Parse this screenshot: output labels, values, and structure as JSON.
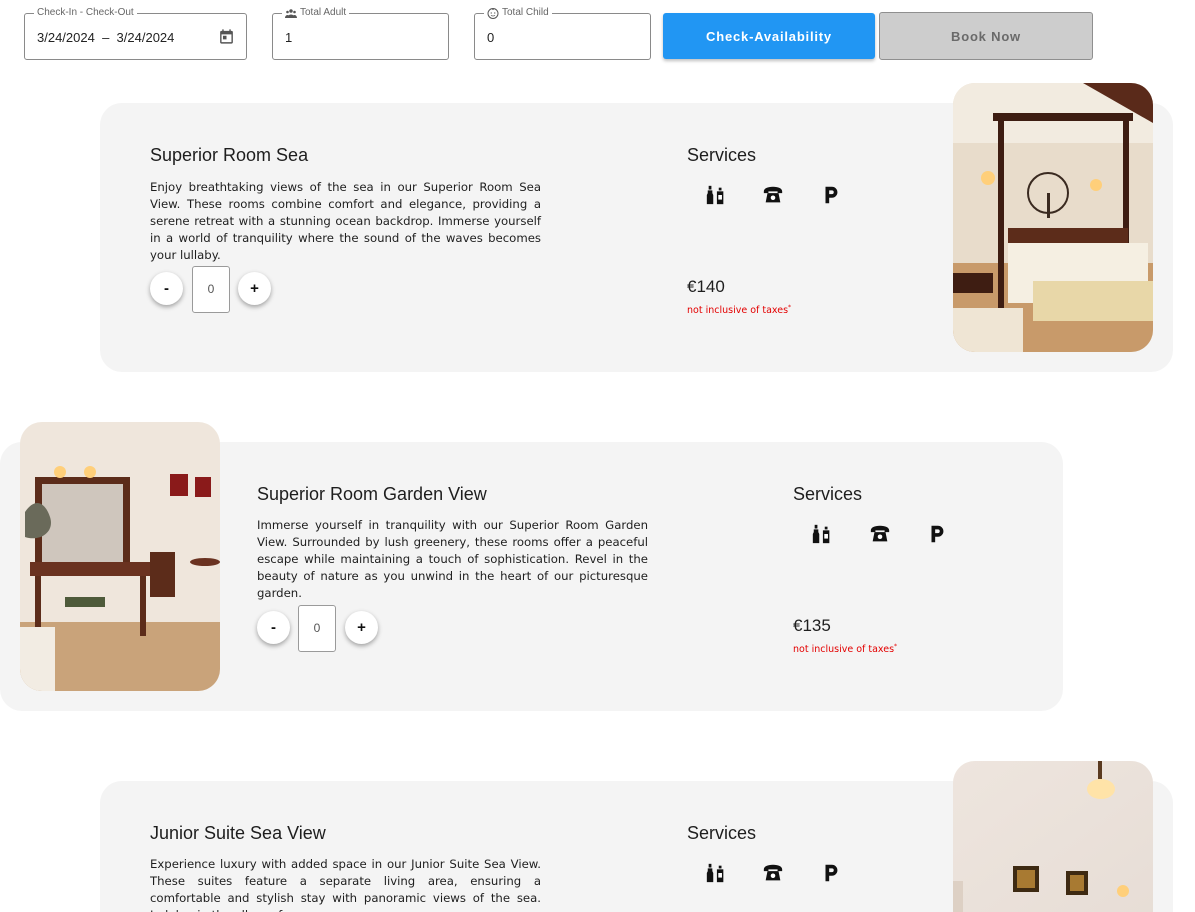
{
  "search": {
    "dates_label": "Check-In - Check-Out",
    "check_in": "3/24/2024",
    "separator": "–",
    "check_out": "3/24/2024",
    "adult_label": "Total Adult",
    "adult_value": "1",
    "child_label": "Total Child",
    "child_value": "0",
    "check_button": "Check-Availability",
    "book_button": "Book Now"
  },
  "rooms": [
    {
      "title": "Superior Room Sea",
      "description": "Enjoy breathtaking views of the sea in our Superior Room Sea View. These rooms combine comfort and elegance, providing a serene retreat with a stunning ocean backdrop. Immerse yourself in a world of tranquility where the sound of the waves becomes your lullaby.",
      "quantity": "0",
      "services_title": "Services",
      "price": "€140",
      "tax_note": "not inclusive of taxes",
      "tax_mark": "*"
    },
    {
      "title": "Superior Room Garden View",
      "description": "Immerse yourself in tranquility with our Superior Room Garden View. Surrounded by lush greenery, these rooms offer a peaceful escape while maintaining a touch of sophistication. Revel in the beauty of nature as you unwind in the heart of our picturesque garden.",
      "quantity": "0",
      "services_title": "Services",
      "price": "€135",
      "tax_note": "not inclusive of taxes",
      "tax_mark": "*"
    },
    {
      "title": "Junior Suite Sea View",
      "description": "Experience luxury with added space in our Junior Suite Sea View. These suites feature a separate living area, ensuring a comfortable and stylish stay with panoramic views of the sea. Indulge in the allure of",
      "services_title": "Services"
    }
  ],
  "buttons": {
    "minus": "-",
    "plus": "+"
  },
  "icons": {
    "calendar": "calendar-icon",
    "adult": "people-icon",
    "child": "child-face-icon",
    "services": [
      "minibar-icon",
      "telephone-icon",
      "parking-icon"
    ]
  },
  "colors": {
    "primary": "#2196f3",
    "disabled": "#cdcdcd",
    "card_bg": "#f4f4f4",
    "tax_red": "#e30000"
  }
}
